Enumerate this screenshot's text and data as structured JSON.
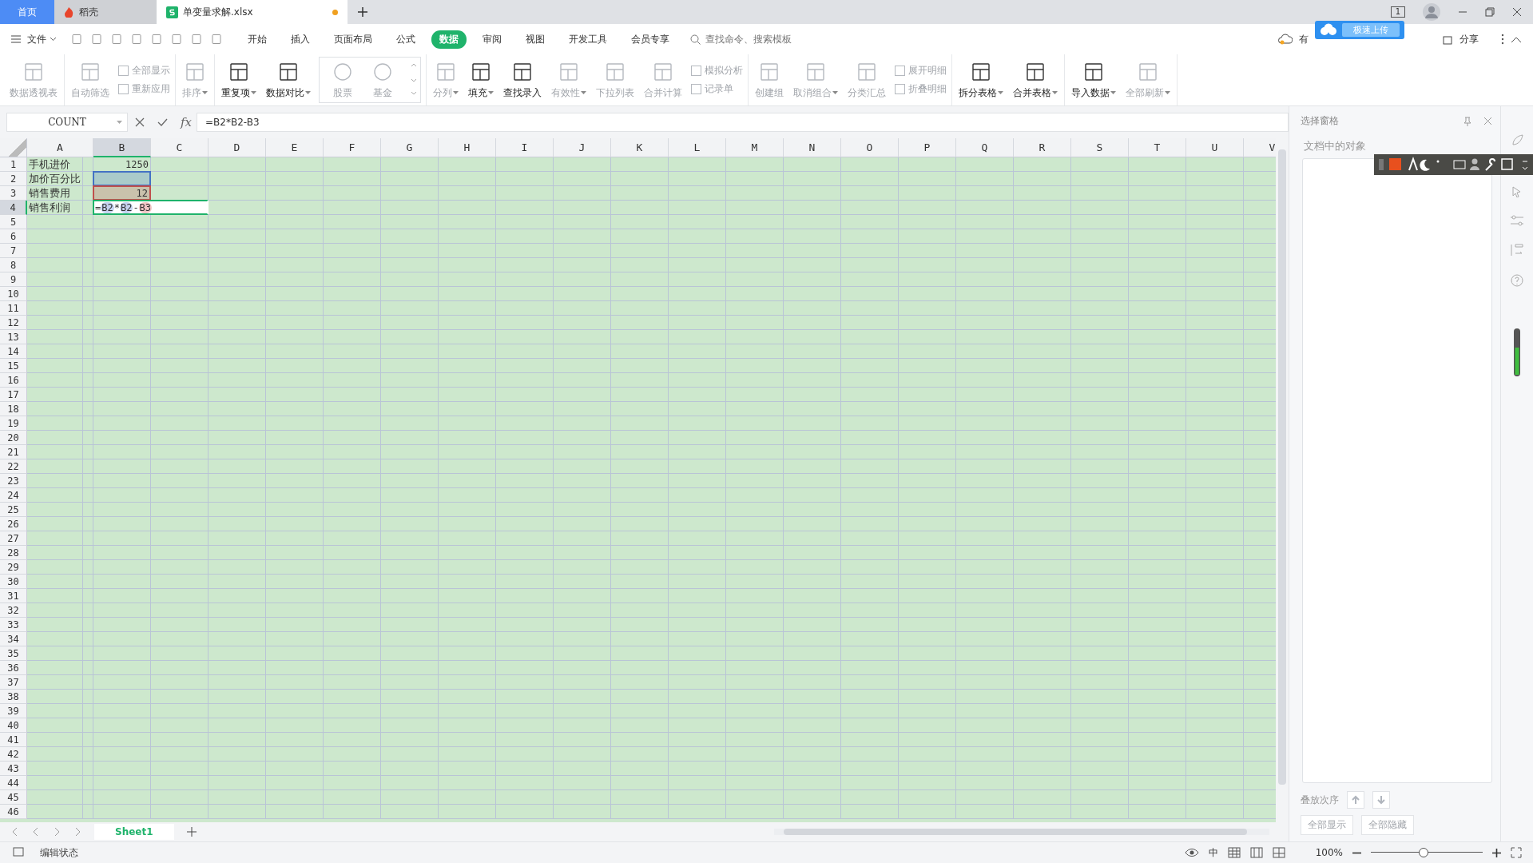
{
  "tabs": [
    {
      "label": "首页",
      "kind": "home",
      "selected": false
    },
    {
      "label": "稻壳",
      "kind": "docer",
      "selected": false
    },
    {
      "label": "单变量求解.xlsx",
      "kind": "sheet",
      "selected": true,
      "unsaved": true
    }
  ],
  "title_bar": {
    "window_count": "1"
  },
  "menu": {
    "file": "文件",
    "tabs": [
      {
        "label": "开始",
        "selected": false
      },
      {
        "label": "插入",
        "selected": false
      },
      {
        "label": "页面布局",
        "selected": false
      },
      {
        "label": "公式",
        "selected": false
      },
      {
        "label": "数据",
        "selected": true
      },
      {
        "label": "审阅",
        "selected": false
      },
      {
        "label": "视图",
        "selected": false
      },
      {
        "label": "开发工具",
        "selected": false
      },
      {
        "label": "会员专享",
        "selected": false
      }
    ],
    "search_placeholder": "查找命令、搜索模板",
    "cloud_status": "有",
    "upload_popup": "极速上传",
    "share": "分享"
  },
  "ribbon": [
    {
      "items": [
        {
          "label": "数据透视表",
          "kind": "large",
          "disabled": true,
          "dropdown": false
        }
      ]
    },
    {
      "items": [
        {
          "label": "自动筛选",
          "kind": "large",
          "disabled": true,
          "dropdown": false
        },
        {
          "label": "全部显示",
          "kind": "small",
          "disabled": true
        },
        {
          "label": "重新应用",
          "kind": "small",
          "disabled": true
        }
      ]
    },
    {
      "items": [
        {
          "label": "排序",
          "kind": "large",
          "disabled": true,
          "dropdown": true
        }
      ]
    },
    {
      "items": [
        {
          "label": "重复项",
          "kind": "large",
          "disabled": false,
          "dropdown": true
        },
        {
          "label": "数据对比",
          "kind": "large",
          "disabled": false,
          "dropdown": true
        },
        {
          "label": "股票",
          "kind": "gallery",
          "disabled": true
        },
        {
          "label": "基金",
          "kind": "gallery",
          "disabled": true
        }
      ]
    },
    {
      "items": [
        {
          "label": "分列",
          "kind": "large",
          "disabled": true,
          "dropdown": true
        },
        {
          "label": "填充",
          "kind": "large",
          "disabled": false,
          "dropdown": true
        },
        {
          "label": "查找录入",
          "kind": "large",
          "disabled": false,
          "dropdown": false
        },
        {
          "label": "有效性",
          "kind": "large",
          "disabled": true,
          "dropdown": true
        },
        {
          "label": "下拉列表",
          "kind": "large",
          "disabled": true,
          "dropdown": false
        },
        {
          "label": "合并计算",
          "kind": "large",
          "disabled": true,
          "dropdown": false
        },
        {
          "label": "模拟分析",
          "kind": "small",
          "disabled": true
        },
        {
          "label": "记录单",
          "kind": "small",
          "disabled": true
        }
      ]
    },
    {
      "items": [
        {
          "label": "创建组",
          "kind": "large",
          "disabled": true,
          "dropdown": false
        },
        {
          "label": "取消组合",
          "kind": "large",
          "disabled": true,
          "dropdown": true
        },
        {
          "label": "分类汇总",
          "kind": "large",
          "disabled": true,
          "dropdown": false
        },
        {
          "label": "展开明细",
          "kind": "small",
          "disabled": true
        },
        {
          "label": "折叠明细",
          "kind": "small",
          "disabled": true
        }
      ]
    },
    {
      "items": [
        {
          "label": "拆分表格",
          "kind": "large",
          "disabled": false,
          "dropdown": true
        },
        {
          "label": "合并表格",
          "kind": "large",
          "disabled": false,
          "dropdown": true
        }
      ]
    },
    {
      "items": [
        {
          "label": "导入数据",
          "kind": "large",
          "disabled": false,
          "dropdown": true
        },
        {
          "label": "全部刷新",
          "kind": "large",
          "disabled": true,
          "dropdown": true
        }
      ]
    }
  ],
  "formula_bar": {
    "name_box": "COUNT",
    "fx": "fx",
    "formula": "=B2*B2-B3"
  },
  "columns": [
    {
      "label": "A",
      "selected": false
    },
    {
      "label": "B",
      "selected": true
    },
    {
      "label": "C",
      "selected": false
    },
    {
      "label": "D",
      "selected": false
    },
    {
      "label": "E",
      "selected": false
    },
    {
      "label": "F",
      "selected": false
    },
    {
      "label": "G",
      "selected": false
    },
    {
      "label": "H",
      "selected": false
    },
    {
      "label": "I",
      "selected": false
    },
    {
      "label": "J",
      "selected": false
    },
    {
      "label": "K",
      "selected": false
    },
    {
      "label": "L",
      "selected": false
    },
    {
      "label": "M",
      "selected": false
    },
    {
      "label": "N",
      "selected": false
    },
    {
      "label": "O",
      "selected": false
    },
    {
      "label": "P",
      "selected": false
    },
    {
      "label": "Q",
      "selected": false
    },
    {
      "label": "R",
      "selected": false
    },
    {
      "label": "S",
      "selected": false
    },
    {
      "label": "T",
      "selected": false
    },
    {
      "label": "U",
      "selected": false
    },
    {
      "label": "V",
      "selected": false
    }
  ],
  "rows": [
    {
      "header": "1",
      "selected": false,
      "cells": [
        {
          "kind": "text",
          "text": "手机进价"
        },
        {
          "kind": "number",
          "text": "1250"
        }
      ]
    },
    {
      "header": "2",
      "selected": false,
      "cells": [
        {
          "kind": "text",
          "text": "加价百分比"
        },
        {
          "kind": "reference",
          "color": "#4472c4"
        }
      ]
    },
    {
      "header": "3",
      "selected": false,
      "cells": [
        {
          "kind": "text",
          "text": "销售费用"
        },
        {
          "kind": "reference",
          "color": "#c0504d",
          "text": "12"
        }
      ]
    },
    {
      "header": "4",
      "selected": true,
      "cells": [
        {
          "kind": "text",
          "text": "销售利润"
        },
        {
          "kind": "editing",
          "tokens": [
            {
              "text": "=",
              "kind": "operator"
            },
            {
              "text": "B2",
              "kind": "ref",
              "color": "#c6d2f0"
            },
            {
              "text": "*",
              "kind": "operator"
            },
            {
              "text": "B2",
              "kind": "ref",
              "color": "#c6d2f0"
            },
            {
              "text": "-",
              "kind": "operator"
            },
            {
              "text": "B3",
              "kind": "ref",
              "color": "#f2c6c6"
            }
          ]
        }
      ]
    },
    {
      "header": "5",
      "selected": false,
      "cells": []
    },
    {
      "header": "6",
      "selected": false,
      "cells": []
    },
    {
      "header": "7",
      "selected": false,
      "cells": []
    },
    {
      "header": "8",
      "selected": false,
      "cells": []
    },
    {
      "header": "9",
      "selected": false,
      "cells": []
    },
    {
      "header": "10",
      "selected": false,
      "cells": []
    },
    {
      "header": "11",
      "selected": false,
      "cells": []
    },
    {
      "header": "12",
      "selected": false,
      "cells": []
    },
    {
      "header": "13",
      "selected": false,
      "cells": []
    },
    {
      "header": "14",
      "selected": false,
      "cells": []
    },
    {
      "header": "15",
      "selected": false,
      "cells": []
    },
    {
      "header": "16",
      "selected": false,
      "cells": []
    },
    {
      "header": "17",
      "selected": false,
      "cells": []
    },
    {
      "header": "18",
      "selected": false,
      "cells": []
    },
    {
      "header": "19",
      "selected": false,
      "cells": []
    },
    {
      "header": "20",
      "selected": false,
      "cells": []
    },
    {
      "header": "21",
      "selected": false,
      "cells": []
    },
    {
      "header": "22",
      "selected": false,
      "cells": []
    },
    {
      "header": "23",
      "selected": false,
      "cells": []
    },
    {
      "header": "24",
      "selected": false,
      "cells": []
    },
    {
      "header": "25",
      "selected": false,
      "cells": []
    },
    {
      "header": "26",
      "selected": false,
      "cells": []
    },
    {
      "header": "27",
      "selected": false,
      "cells": []
    },
    {
      "header": "28",
      "selected": false,
      "cells": []
    },
    {
      "header": "29",
      "selected": false,
      "cells": []
    },
    {
      "header": "30",
      "selected": false,
      "cells": []
    },
    {
      "header": "31",
      "selected": false,
      "cells": []
    },
    {
      "header": "32",
      "selected": false,
      "cells": []
    },
    {
      "header": "33",
      "selected": false,
      "cells": []
    },
    {
      "header": "34",
      "selected": false,
      "cells": []
    },
    {
      "header": "35",
      "selected": false,
      "cells": []
    },
    {
      "header": "36",
      "selected": false,
      "cells": []
    },
    {
      "header": "37",
      "selected": false,
      "cells": []
    },
    {
      "header": "38",
      "selected": false,
      "cells": []
    },
    {
      "header": "39",
      "selected": false,
      "cells": []
    },
    {
      "header": "40",
      "selected": false,
      "cells": []
    },
    {
      "header": "41",
      "selected": false,
      "cells": []
    },
    {
      "header": "42",
      "selected": false,
      "cells": []
    },
    {
      "header": "43",
      "selected": false,
      "cells": []
    },
    {
      "header": "44",
      "selected": false,
      "cells": []
    },
    {
      "header": "45",
      "selected": false,
      "cells": []
    },
    {
      "header": "46",
      "selected": false,
      "cells": []
    }
  ],
  "sheet_tabs": [
    {
      "label": "Sheet1",
      "selected": true
    }
  ],
  "selection_pane": {
    "title": "选择窗格",
    "subtitle": "文档中的对象",
    "order_label": "叠放次序",
    "buttons": [
      {
        "label": "全部显示",
        "disabled": true
      },
      {
        "label": "全部隐藏",
        "disabled": true
      }
    ]
  },
  "status_bar": {
    "mode": "编辑状态",
    "ime_label": "中",
    "zoom": "100%",
    "zoom_slider": {
      "level": 0.47
    }
  }
}
